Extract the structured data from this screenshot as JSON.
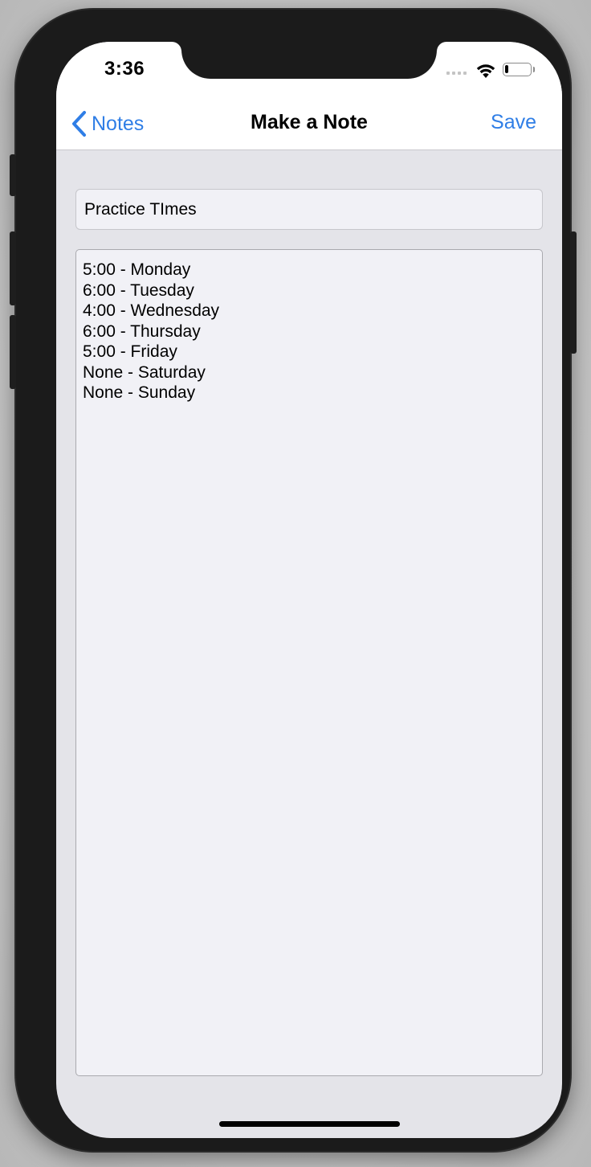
{
  "status_bar": {
    "time": "3:36",
    "battery_level": 0.15
  },
  "navbar": {
    "back_label": "Notes",
    "title": "Make a Note",
    "save_label": "Save"
  },
  "note": {
    "title_value": "Practice TImes",
    "body_lines": [
      "5:00 - Monday",
      "6:00 - Tuesday",
      "4:00 - Wednesday",
      "6:00 - Thursday",
      "5:00 - Friday",
      "None - Saturday",
      "None - Sunday"
    ]
  },
  "icons": {
    "back": "chevron-left-icon",
    "wifi": "wifi-icon",
    "battery": "battery-icon",
    "signal": "cellular-signal-icon"
  },
  "colors": {
    "accent": "#2f7ee6",
    "background": "#e4e4e9",
    "field": "#f1f1f6"
  }
}
